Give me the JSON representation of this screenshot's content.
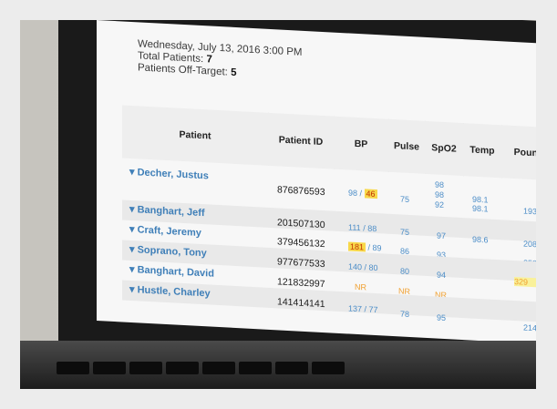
{
  "header": {
    "datetime": "Wednesday, July 13, 2016 3:00 PM",
    "total_label": "Total Patients:",
    "total_value": "7",
    "offtarget_label": "Patients Off-Target:",
    "offtarget_value": "5"
  },
  "columns": [
    "Patient",
    "Patient ID",
    "BP",
    "Pulse",
    "SpO2",
    "Temp",
    "Pound"
  ],
  "patients": [
    {
      "name": "Decher, Justus",
      "id": "876876593",
      "bp_sys": "98",
      "bp_dia": "46",
      "pulse": "75",
      "spo2": "98",
      "spo2_b": "98",
      "spo2_c": "92",
      "temp": "98.1",
      "temp_b": "98.1",
      "pound": "193"
    },
    {
      "name": "Banghart, Jeff",
      "id": "201507130",
      "bp_sys": "111",
      "bp_dia": "88",
      "pulse": "75",
      "spo2": "97",
      "temp": "98.6",
      "pound": "208"
    },
    {
      "name": "Craft, Jeremy",
      "id": "379456132",
      "bp_sys": "181",
      "bp_dia": "89",
      "pulse": "86",
      "spo2": "93",
      "temp": "",
      "pound": "258"
    },
    {
      "name": "Soprano, Tony",
      "id": "977677533",
      "bp_sys": "140",
      "bp_dia": "80",
      "pulse": "80",
      "spo2": "94",
      "temp": "",
      "pound": "329"
    },
    {
      "name": "Banghart, David",
      "id": "121832997",
      "bp": "NR",
      "pulse": "NR",
      "spo2": "NR",
      "temp": "",
      "pound": ""
    },
    {
      "name": "Hustle, Charley",
      "id": "141414141",
      "bp_sys": "137",
      "bp_dia": "77",
      "pulse": "78",
      "spo2": "95",
      "temp": "",
      "pound": "214"
    }
  ]
}
